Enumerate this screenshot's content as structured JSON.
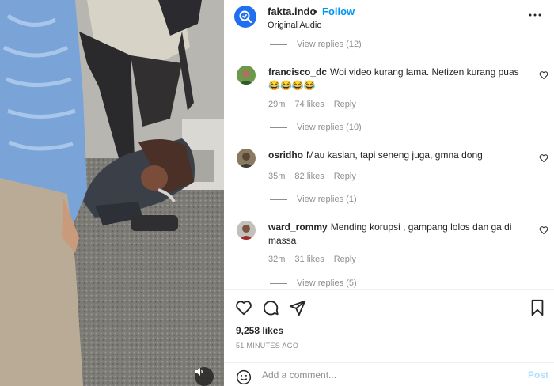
{
  "post": {
    "username": "fakta.indo",
    "separator": "•",
    "follow_label": "Follow",
    "audio": "Original Audio",
    "likes": "9,258 likes",
    "time_ago": "51 MINUTES AGO"
  },
  "comments": [
    {
      "user": "francisco_dc",
      "text": "Woi video kurang lama. Netizen kurang puas 😂😂😂😂",
      "time": "29m",
      "likes": "74 likes",
      "reply_label": "Reply",
      "view_replies": "View replies (10)"
    },
    {
      "user": "osridho",
      "text": "Mau kasian, tapi seneng juga, gmna dong",
      "time": "35m",
      "likes": "82 likes",
      "reply_label": "Reply",
      "view_replies": "View replies (1)"
    },
    {
      "user": "ward_rommy",
      "text": "Mending korupsi , gampang lolos dan ga di massa",
      "time": "32m",
      "likes": "31 likes",
      "reply_label": "Reply",
      "view_replies": "View replies (5)"
    }
  ],
  "previous_view_replies": "View replies (12)",
  "add_comment": {
    "placeholder": "Add a comment...",
    "post_label": "Post"
  },
  "icons": {
    "avatar": "search-check-logo",
    "more": "more-icon",
    "like": "heart-icon",
    "comment": "comment-icon",
    "share": "send-icon",
    "save": "bookmark-icon",
    "emoji": "emoji-icon",
    "mute": "speaker-icon"
  },
  "colors": {
    "follow": "#0095f6",
    "post_disabled": "#b2dffc",
    "muted_text": "#8e8e8e",
    "brand_avatar": "#1f6ff0"
  }
}
